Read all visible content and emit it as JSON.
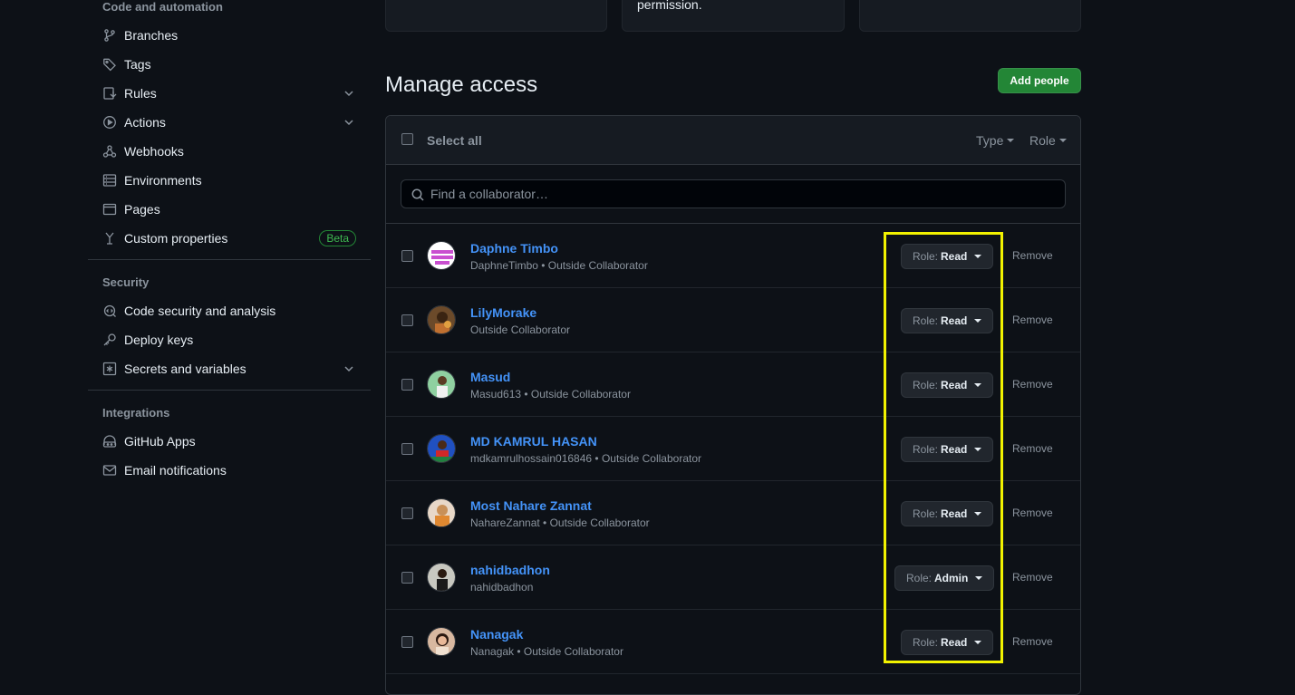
{
  "sidebar": {
    "sections": [
      {
        "title": "Code and automation",
        "items": [
          {
            "label": "Branches",
            "icon": "branch-icon"
          },
          {
            "label": "Tags",
            "icon": "tag-icon"
          },
          {
            "label": "Rules",
            "icon": "rules-icon",
            "expandable": true
          },
          {
            "label": "Actions",
            "icon": "play-icon",
            "expandable": true
          },
          {
            "label": "Webhooks",
            "icon": "webhook-icon"
          },
          {
            "label": "Environments",
            "icon": "server-icon"
          },
          {
            "label": "Pages",
            "icon": "browser-icon"
          },
          {
            "label": "Custom properties",
            "icon": "custom-properties-icon",
            "badge": "Beta"
          }
        ]
      },
      {
        "title": "Security",
        "items": [
          {
            "label": "Code security and analysis",
            "icon": "codescan-icon"
          },
          {
            "label": "Deploy keys",
            "icon": "key-icon"
          },
          {
            "label": "Secrets and variables",
            "icon": "asterisk-icon",
            "expandable": true
          }
        ]
      },
      {
        "title": "Integrations",
        "items": [
          {
            "label": "GitHub Apps",
            "icon": "apps-icon"
          },
          {
            "label": "Email notifications",
            "icon": "mail-icon"
          }
        ]
      }
    ]
  },
  "cards": {
    "middle_text": "permission."
  },
  "header": {
    "title": "Manage access",
    "add_button": "Add people"
  },
  "table": {
    "select_all": "Select all",
    "filter_type": "Type",
    "filter_role": "Role",
    "search_placeholder": "Find a collaborator…",
    "role_prefix": "Role:",
    "remove_label": "Remove",
    "rows": [
      {
        "name": "Daphne Timbo",
        "meta": "DaphneTimbo • Outside Collaborator",
        "role": "Read"
      },
      {
        "name": "LilyMorake",
        "meta": "Outside Collaborator",
        "role": "Read"
      },
      {
        "name": "Masud",
        "meta": "Masud613 • Outside Collaborator",
        "role": "Read"
      },
      {
        "name": "MD KAMRUL HASAN",
        "meta": "mdkamrulhossain016846 • Outside Collaborator",
        "role": "Read"
      },
      {
        "name": "Most Nahare Zannat",
        "meta": "NahareZannat • Outside Collaborator",
        "role": "Read"
      },
      {
        "name": "nahidbadhon",
        "meta": "nahidbadhon",
        "role": "Admin"
      },
      {
        "name": "Nanagak",
        "meta": "Nanagak • Outside Collaborator",
        "role": "Read"
      }
    ]
  },
  "colors": {
    "accent": "#238636",
    "link": "#4493f8",
    "highlight": "#f2f200",
    "background": "#0d1117"
  }
}
